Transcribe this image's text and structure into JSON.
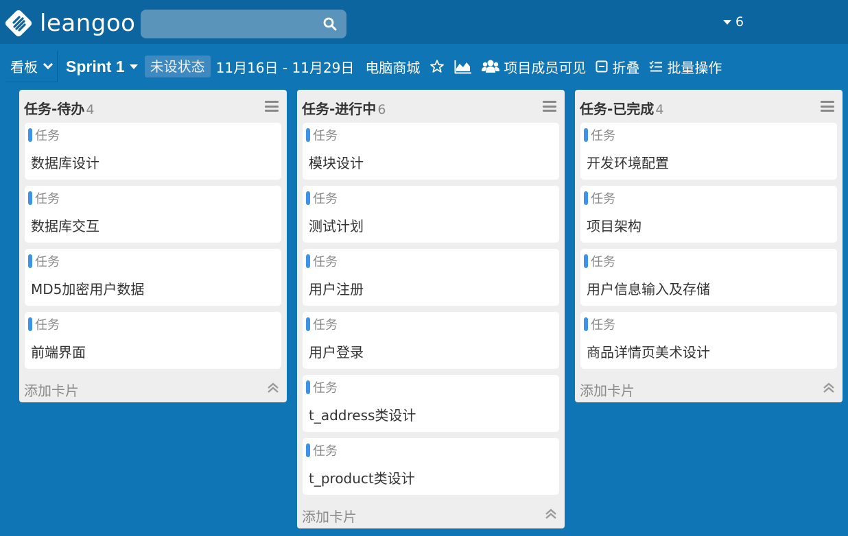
{
  "app": {
    "logo_text": "leangoo",
    "notification_count": "6"
  },
  "search": {
    "placeholder": ""
  },
  "toolbar": {
    "view_label": "看板",
    "sprint_label": "Sprint 1",
    "status_label": "未设状态",
    "date_range": "11月16日 - 11月29日",
    "project_name": "电脑商城",
    "visibility_label": "项目成员可见",
    "collapse_label": "折叠",
    "batch_label": "批量操作",
    "icons": [
      "chevron-down-icon",
      "caret-down-icon",
      "star-icon",
      "area-chart-icon",
      "users-icon",
      "minus-square-icon",
      "checklist-icon"
    ]
  },
  "lists": [
    {
      "title": "任务-待办",
      "count": "4",
      "cards": [
        {
          "label": "任务",
          "title": "数据库设计"
        },
        {
          "label": "任务",
          "title": "数据库交互"
        },
        {
          "label": "任务",
          "title": "MD5加密用户数据"
        },
        {
          "label": "任务",
          "title": "前端界面"
        }
      ],
      "add_card_label": "添加卡片"
    },
    {
      "title": "任务-进行中",
      "count": "6",
      "cards": [
        {
          "label": "任务",
          "title": "模块设计"
        },
        {
          "label": "任务",
          "title": "测试计划"
        },
        {
          "label": "任务",
          "title": "用户注册"
        },
        {
          "label": "任务",
          "title": "用户登录"
        },
        {
          "label": "任务",
          "title": "t_address类设计"
        },
        {
          "label": "任务",
          "title": "t_product类设计"
        }
      ],
      "add_card_label": "添加卡片"
    },
    {
      "title": "任务-已完成",
      "count": "4",
      "cards": [
        {
          "label": "任务",
          "title": "开发环境配置"
        },
        {
          "label": "任务",
          "title": "项目架构"
        },
        {
          "label": "任务",
          "title": "用户信息输入及存储"
        },
        {
          "label": "任务",
          "title": "商品详情页美术设计"
        }
      ],
      "add_card_label": "添加卡片"
    }
  ],
  "colors": {
    "background": "#0f75b5",
    "topbar": "#0c659f",
    "label_blue": "#3d93e8"
  }
}
